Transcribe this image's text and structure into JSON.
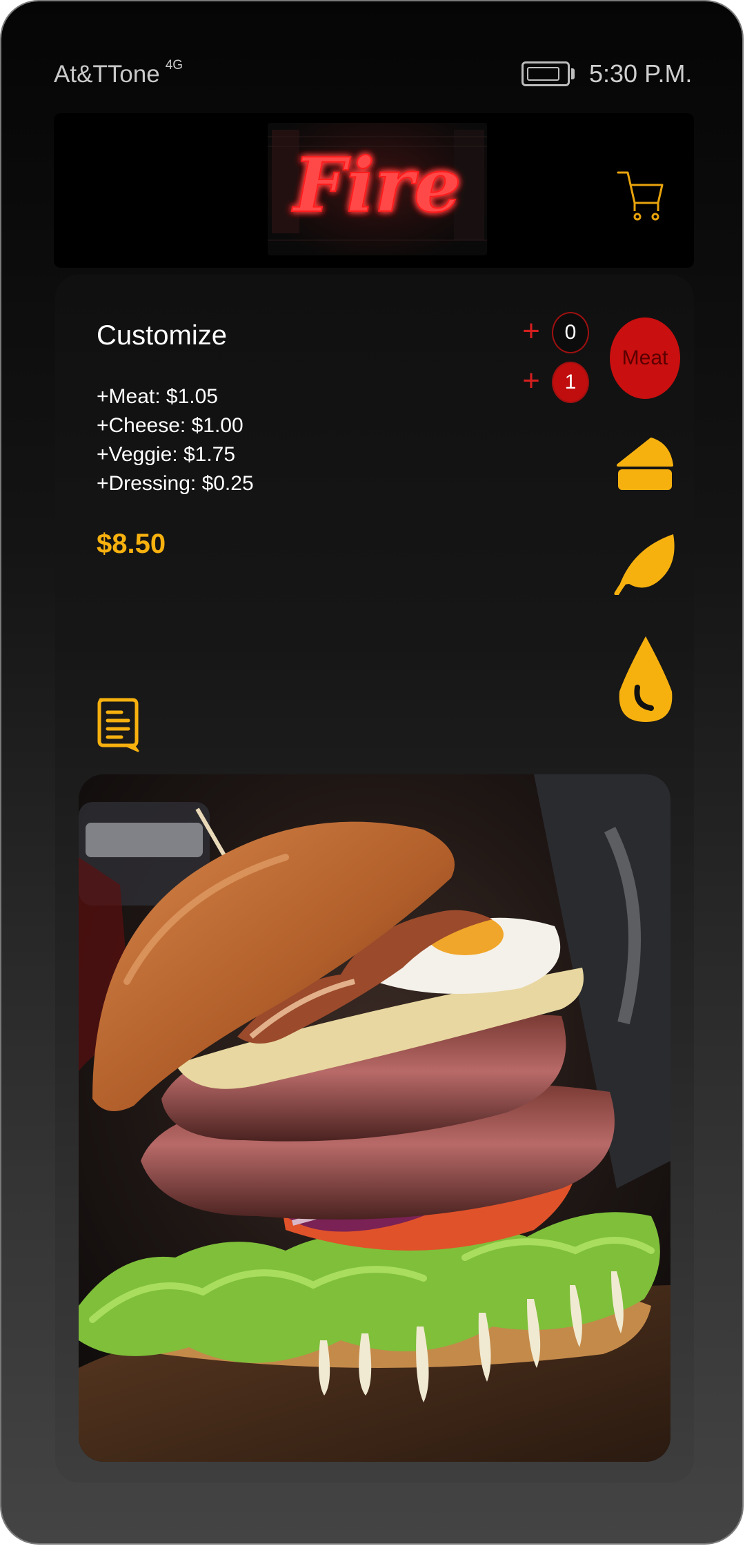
{
  "status_bar": {
    "carrier": "At&TTone",
    "network": "4G",
    "time": "5:30 P.M."
  },
  "header": {
    "logo_text": "Fire",
    "cart_icon": "cart-icon"
  },
  "customize": {
    "title": "Customize",
    "prices": [
      {
        "label": "+Meat: $1.05"
      },
      {
        "label": "+Cheese: $1.00"
      },
      {
        "label": "+Veggie: $1.75"
      },
      {
        "label": "+Dressing: $0.25"
      }
    ],
    "total": "$8.50",
    "note_icon": "notes-icon"
  },
  "steppers": [
    {
      "plus": "+",
      "count": "0"
    },
    {
      "plus": "+",
      "count": "1"
    }
  ],
  "categories": {
    "meat_label": "Meat",
    "icons": [
      "cheese-icon",
      "leaf-icon",
      "drop-icon"
    ]
  },
  "colors": {
    "accent_yellow": "#f7b10f",
    "accent_red": "#c90f0f",
    "neon_red": "#ff2a2a"
  }
}
